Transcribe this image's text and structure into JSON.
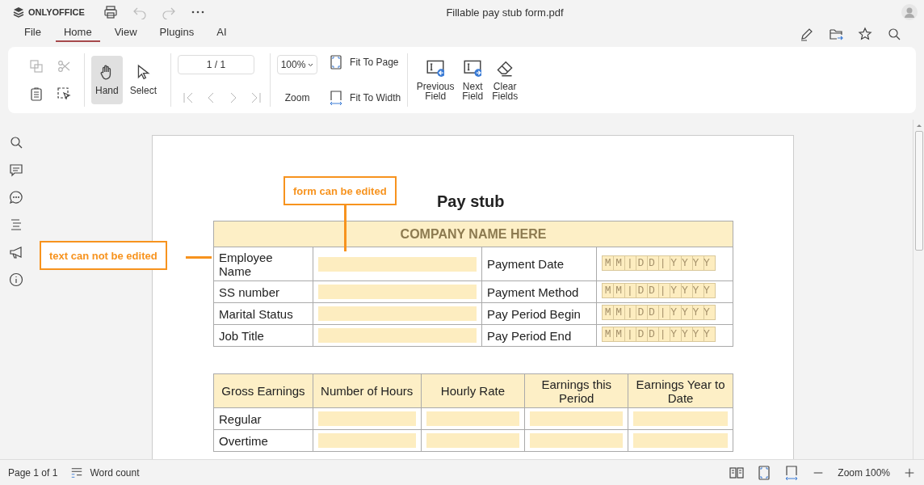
{
  "app": {
    "logo": "ONLYOFFICE",
    "title": "Fillable pay stub form.pdf"
  },
  "menu": [
    {
      "label": "File",
      "selected": false
    },
    {
      "label": "Home",
      "selected": true
    },
    {
      "label": "View",
      "selected": false
    },
    {
      "label": "Plugins",
      "selected": false
    },
    {
      "label": "AI",
      "selected": false
    }
  ],
  "toolbar": {
    "clipboard": [
      {
        "kind": "copy",
        "disabled": true
      },
      {
        "kind": "cut",
        "disabled": true
      },
      {
        "kind": "paste",
        "disabled": false
      },
      {
        "kind": "selectarea",
        "disabled": false
      }
    ],
    "tools": [
      {
        "kind": "hand",
        "label": "Hand",
        "selected": true
      },
      {
        "kind": "select",
        "label": "Select",
        "selected": false
      }
    ],
    "page_field": "1 / 1",
    "nav": [
      {
        "kind": "first",
        "disabled": true
      },
      {
        "kind": "prev",
        "disabled": true
      },
      {
        "kind": "next",
        "disabled": true
      },
      {
        "kind": "last",
        "disabled": true
      }
    ],
    "zoom_value": "100%",
    "zoom_label": "Zoom",
    "fit": [
      {
        "kind": "fitpage",
        "label": "Fit To Page"
      },
      {
        "kind": "fitwidth",
        "label": "Fit To Width"
      }
    ],
    "fields": [
      {
        "kind": "prevfield",
        "label": "Previous Field"
      },
      {
        "kind": "nextfield",
        "label": "Next Field"
      },
      {
        "kind": "clear",
        "label": "Clear Fields"
      }
    ]
  },
  "document": {
    "title": "Pay stub",
    "company": "COMPANY NAME HERE",
    "info_rows": [
      {
        "label": "Employee Name",
        "date_label": "Payment Date",
        "date_placeholder": "MM|DD|YYYY"
      },
      {
        "label": "SS number",
        "date_label": "Payment Method",
        "date_placeholder": "MM|DD|YYYY"
      },
      {
        "label": "Marital Status",
        "date_label": "Pay Period Begin",
        "date_placeholder": "MM|DD|YYYY"
      },
      {
        "label": "Job Title",
        "date_label": "Pay Period End",
        "date_placeholder": "MM|DD|YYYY"
      }
    ],
    "earnings": {
      "columns": [
        "Gross Earnings",
        "Number of Hours",
        "Hourly Rate",
        "Earnings this Period",
        "Earnings Year to Date"
      ],
      "rows": [
        {
          "label": "Regular"
        },
        {
          "label": "Overtime"
        }
      ]
    }
  },
  "callouts": [
    {
      "kind": "form",
      "text": "form can be edited"
    },
    {
      "kind": "text",
      "text": "text can not be edited"
    }
  ],
  "status_bar": {
    "page": "Page 1 of 1",
    "word_count": "Word count",
    "zoom": "Zoom 100%"
  }
}
